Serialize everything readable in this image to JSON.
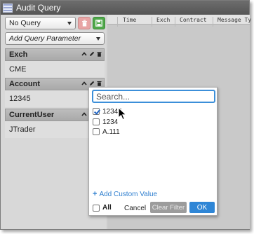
{
  "window": {
    "title": "Audit Query",
    "icon": "list-grid-icon"
  },
  "toolbar": {
    "query_select_value": "No Query",
    "delete_icon": "trash-icon",
    "save_icon": "save-icon",
    "add_param_label": "Add Query Parameter"
  },
  "params": [
    {
      "name": "Exch",
      "value": "CME"
    },
    {
      "name": "Account",
      "value": "12345"
    },
    {
      "name": "CurrentUser",
      "value": "JTrader"
    }
  ],
  "grid": {
    "columns": [
      "Time",
      "Exch",
      "Contract",
      "Message Ty"
    ]
  },
  "filter_popup": {
    "search_placeholder": "Search...",
    "search_value": "",
    "options": [
      {
        "label": "12345",
        "checked": true
      },
      {
        "label": "1234",
        "checked": false
      },
      {
        "label": "A.111",
        "checked": false
      }
    ],
    "add_custom_label": "Add Custom Value",
    "all_label": "All",
    "cancel_label": "Cancel",
    "clear_label": "Clear Filter",
    "ok_label": "OK"
  },
  "colors": {
    "accent": "#2f86d6",
    "save_green": "#4fa84a",
    "delete_red": "#e8a5a5",
    "link": "#2f7fcf"
  }
}
